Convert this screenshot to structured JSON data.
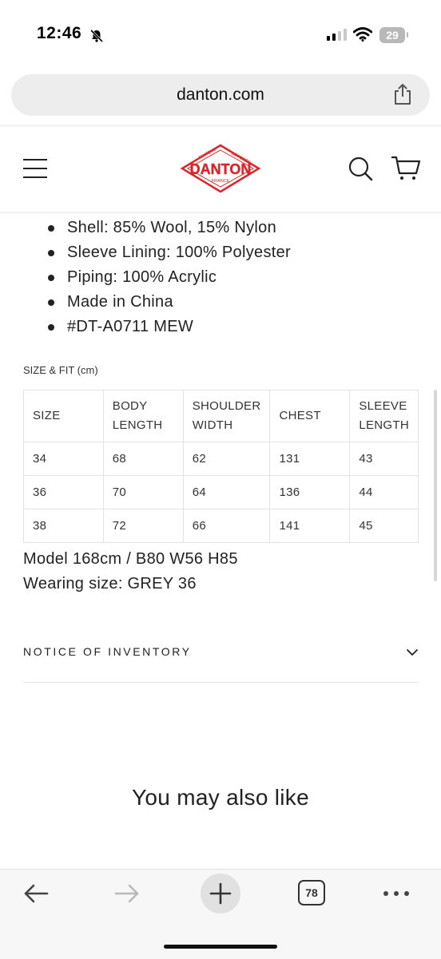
{
  "status_bar": {
    "time": "12:46",
    "battery": "29",
    "icons": [
      "bell-muted-icon",
      "cellular-signal-icon",
      "wifi-icon",
      "battery-icon"
    ]
  },
  "browser": {
    "url": "danton.com",
    "share_icon": "share-icon"
  },
  "site_header": {
    "menu_icon": "hamburger-menu-icon",
    "logo": {
      "main": "DANTON",
      "arc_left": "MARQUE",
      "arc_right": "DÉPOSÉE",
      "bottom": "FRANCE"
    },
    "search_icon": "search-icon",
    "cart_icon": "cart-icon",
    "accent_color": "#d9262b"
  },
  "product_specs": [
    "Shell: 85% Wool, 15% Nylon",
    "Sleeve Lining: 100% Polyester",
    "Piping: 100% Acrylic",
    "Made in China",
    "#DT-A0711 MEW"
  ],
  "size_fit": {
    "heading": "SIZE & FIT (cm)",
    "columns": [
      [
        "SIZE"
      ],
      [
        "BODY",
        "LENGTH"
      ],
      [
        "SHOULDER",
        "WIDTH"
      ],
      [
        "CHEST"
      ],
      [
        "SLEEVE",
        "LENGTH"
      ]
    ],
    "rows": [
      [
        "34",
        "68",
        "62",
        "131",
        "43"
      ],
      [
        "36",
        "70",
        "64",
        "136",
        "44"
      ],
      [
        "38",
        "72",
        "66",
        "141",
        "45"
      ]
    ]
  },
  "model_info": [
    "Model 168cm / B80 W56 H85",
    "Wearing size: GREY 36"
  ],
  "notice": {
    "label": "NOTICE OF INVENTORY",
    "icon": "chevron-down-icon"
  },
  "recommendations": {
    "heading": "You may also like"
  },
  "toolbar": {
    "tab_count": "78",
    "icons": [
      "back-arrow-icon",
      "forward-arrow-icon",
      "new-tab-plus-icon",
      "tabs-icon",
      "more-icon"
    ]
  }
}
